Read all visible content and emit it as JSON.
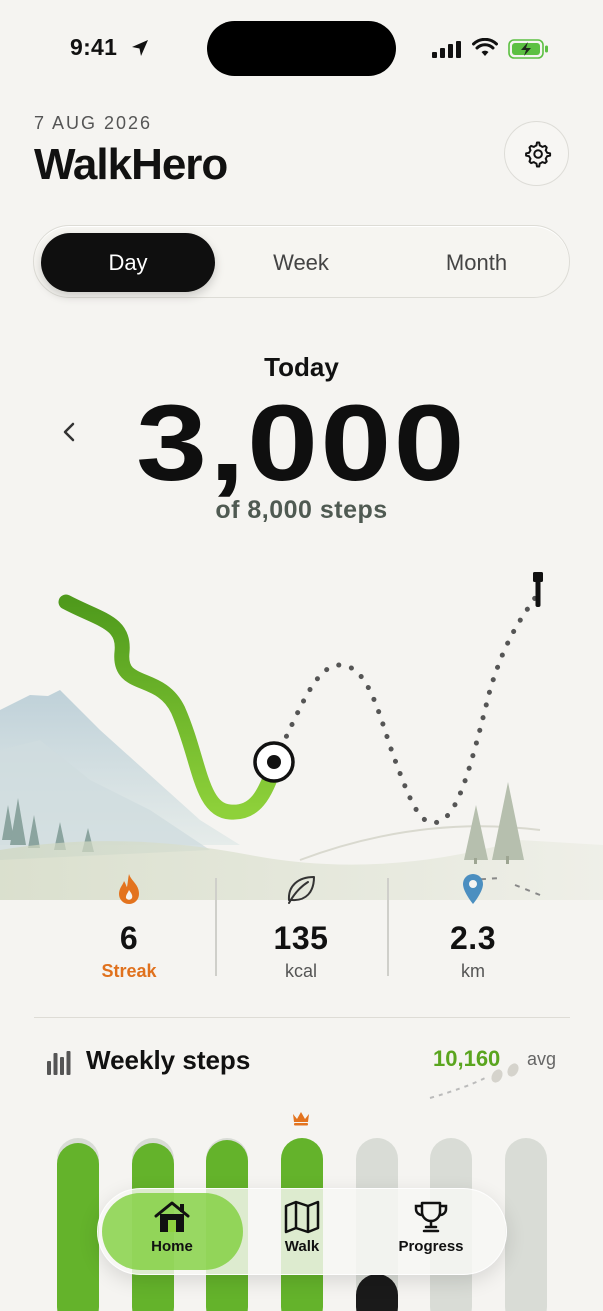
{
  "status_bar": {
    "time": "9:41"
  },
  "header": {
    "date": "7 AUG 2026",
    "title": "WalkHero"
  },
  "segments": {
    "day": "Day",
    "week": "Week",
    "month": "Month",
    "selected": "Day"
  },
  "hero": {
    "label": "Today",
    "steps": "3,000",
    "goal_text": "of 8,000 steps"
  },
  "progress": {
    "steps": 3000,
    "goal": 8000
  },
  "stats": {
    "streak": {
      "value": "6",
      "label": "Streak"
    },
    "kcal": {
      "value": "135",
      "label": "kcal"
    },
    "km": {
      "value": "2.3",
      "label": "km"
    }
  },
  "weekly": {
    "title": "Weekly steps",
    "avg_value": "10,160",
    "avg_label": "avg"
  },
  "tabbar": {
    "home": "Home",
    "walk": "Walk",
    "progress": "Progress",
    "active": "Home"
  },
  "colors": {
    "accent_green": "#64b32b",
    "streak_orange": "#e0711d",
    "location_blue": "#4b8fc0",
    "background": "#f5f4f1"
  }
}
